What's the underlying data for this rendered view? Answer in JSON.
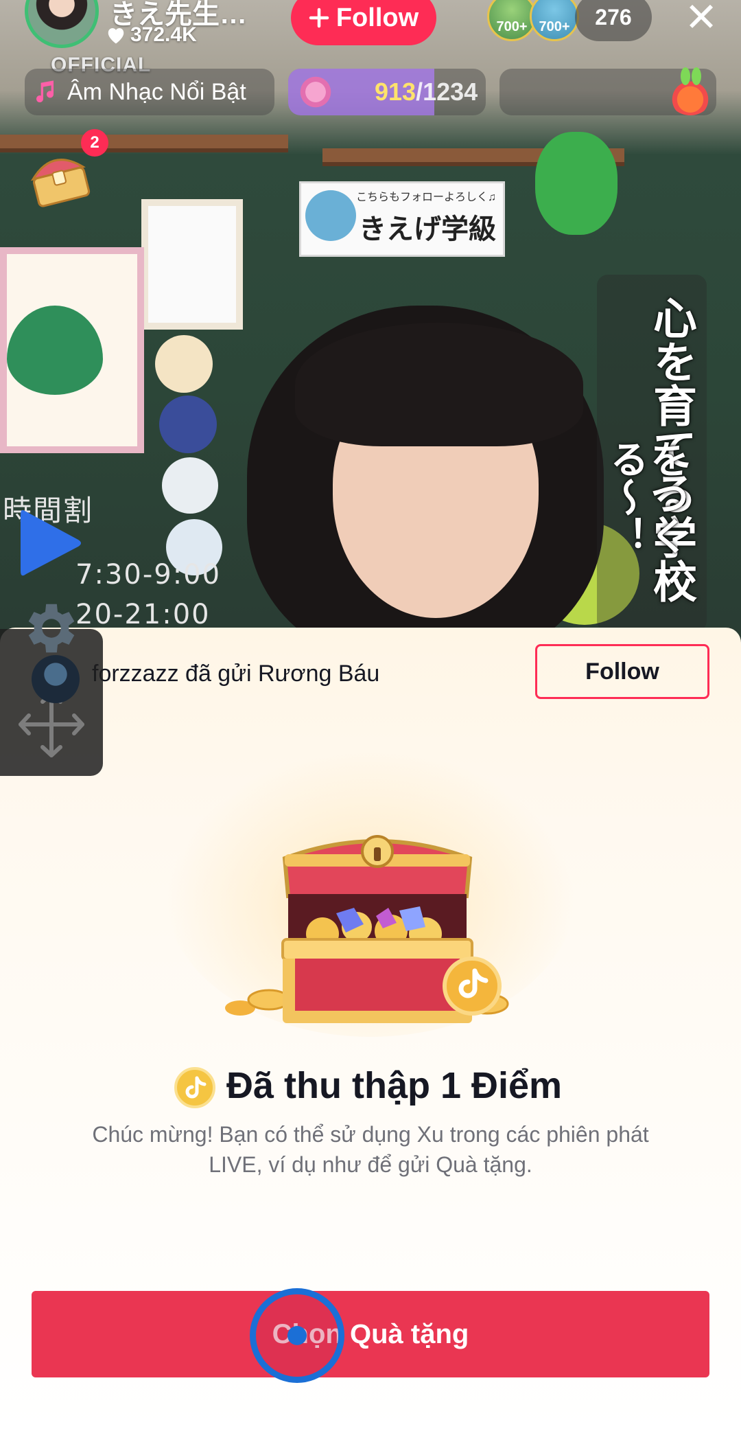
{
  "stream": {
    "host_name": "きえ先生…",
    "likes": "372.4K",
    "badge_text": "OFFICIAL",
    "follow_label": "Follow",
    "viewers": [
      {
        "label": "700+",
        "color": "#4a8f4a"
      },
      {
        "label": "700+",
        "color": "#3f8fb4"
      }
    ],
    "viewer_count": "276",
    "music_label": "Âm Nhạc Nổi Bật",
    "score": {
      "current": "913",
      "total": "/1234",
      "progress": 0.74
    },
    "chest_badge_count": "2",
    "colors": {
      "accent": "#fe2c55",
      "score": "#ffe36b"
    }
  },
  "scene": {
    "sign_text": "きえげ学級",
    "sign_sub": "こちらもフォローよろしく♫",
    "chalk_1": "時間割",
    "chalk_2": "7:30-9:00",
    "chalk_3": "20-21:00",
    "vertical_col_1": "心を育てる学校",
    "vertical_col_2": "をつくる〜！"
  },
  "controls": {
    "play_icon": "play-icon",
    "gear_icon": "gear-icon",
    "move_icon": "move-icon"
  },
  "sheet": {
    "notice_text": "forzzazz đã gửi Rương Báu",
    "follow_label": "Follow",
    "title": "Đã thu thập 1 Điểm",
    "description": "Chúc mừng! Bạn có thể sử dụng Xu trong các phiên phát LIVE, ví dụ như để gửi Quà tặng.",
    "cta_label": "Chọn Quà tặng"
  }
}
